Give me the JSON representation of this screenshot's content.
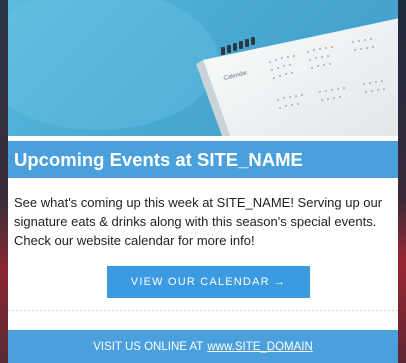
{
  "hero": {
    "image_icon": "calendar-photo",
    "calendar_label": "Calendar",
    "colors": {
      "sky": "#4aa9d2",
      "paper": "#f4f6f7"
    }
  },
  "event": {
    "title": "Upcoming Events at SITE_NAME",
    "description": "See what's coming up this week at SITE_NAME! Serving up our signature eats & drinks along with this season's special events. Check our website calendar for more info!"
  },
  "cta": {
    "label": "VIEW OUR CALENDAR →",
    "color": "#3b9ae1"
  },
  "footer": {
    "prefix": "VISIT US ONLINE AT",
    "link_text": "www.SITE_DOMAIN",
    "color": "#4aa0dc"
  }
}
